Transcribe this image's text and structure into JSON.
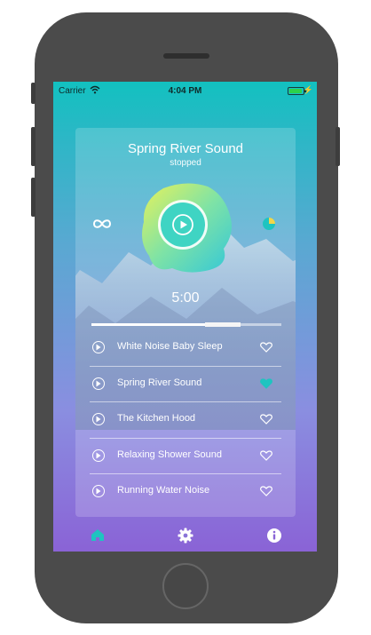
{
  "status_bar": {
    "carrier": "Carrier",
    "time": "4:04 PM",
    "battery_level": 0.9
  },
  "player": {
    "title": "Spring River Sound",
    "status": "stopped",
    "timer": "5:00",
    "progress": 0.7
  },
  "tracks": [
    {
      "name": "White Noise Baby Sleep",
      "favorite": false
    },
    {
      "name": "Spring River Sound",
      "favorite": true
    },
    {
      "name": "The Kitchen Hood",
      "favorite": false
    },
    {
      "name": "Relaxing Shower Sound",
      "favorite": false
    },
    {
      "name": "Running Water Noise",
      "favorite": false
    }
  ],
  "tabs": [
    {
      "icon": "home-icon",
      "active": true
    },
    {
      "icon": "gear-icon",
      "active": false
    },
    {
      "icon": "info-icon",
      "active": false
    }
  ],
  "colors": {
    "accent": "#1fc4c0",
    "favorite": "#1fc4c0",
    "tab_inactive": "#ffffff",
    "phone_body": "#4b4b4b"
  }
}
